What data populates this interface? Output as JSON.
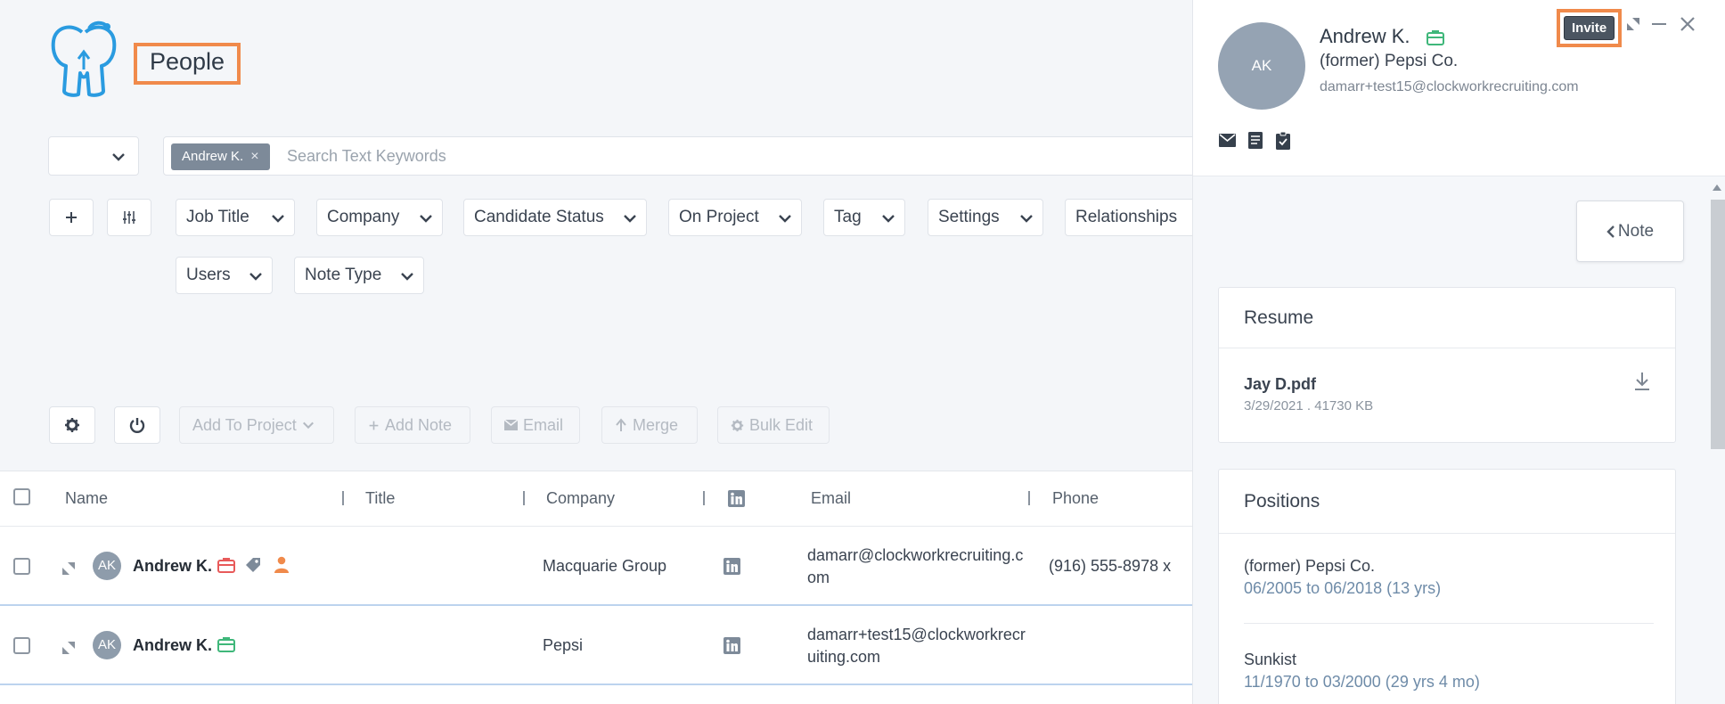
{
  "page": {
    "title": "People"
  },
  "search": {
    "scope_value": "",
    "chip_label": "Andrew K.",
    "chip_remove": "×",
    "placeholder": "Search Text Keywords"
  },
  "filters": {
    "add_icon": "plus-icon",
    "sliders_icon": "sliders-icon",
    "items": [
      {
        "label": "Job Title"
      },
      {
        "label": "Company"
      },
      {
        "label": "Candidate Status"
      },
      {
        "label": "On Project"
      },
      {
        "label": "Tag"
      },
      {
        "label": "Settings"
      },
      {
        "label": "Relationships"
      },
      {
        "label": "Users"
      },
      {
        "label": "Note Type"
      }
    ]
  },
  "actions": {
    "add_to_project": "Add To Project",
    "add_note": "Add Note",
    "email": "Email",
    "merge": "Merge",
    "bulk_edit": "Bulk Edit"
  },
  "table": {
    "columns": {
      "name": "Name",
      "title": "Title",
      "company": "Company",
      "email": "Email",
      "phone": "Phone"
    },
    "rows": [
      {
        "initials": "AK",
        "name": "Andrew K.",
        "title": "",
        "company": "Macquarie Group",
        "email_line1": "damarr@clockworkrecruiting.c",
        "email_line2": "om",
        "phone": "(916) 555-8978 x",
        "icons": [
          "briefcase-icon",
          "tag-icon",
          "person-icon"
        ]
      },
      {
        "initials": "AK",
        "name": "Andrew K.",
        "title": "",
        "company": "Pepsi",
        "email_line1": "damarr+test15@clockworkrecr",
        "email_line2": "uiting.com",
        "phone": "",
        "icons": [
          "briefcase-icon"
        ]
      }
    ]
  },
  "panel": {
    "initials": "AK",
    "name": "Andrew K.",
    "company": "(former) Pepsi Co.",
    "email": "damarr+test15@clockworkrecruiting.com",
    "invite_label": "Invite",
    "note_label": "Note",
    "resume": {
      "title": "Resume",
      "file_name": "Jay D.pdf",
      "meta": "3/29/2021 . 41730 KB"
    },
    "positions": {
      "title": "Positions",
      "items": [
        {
          "company": "(former) Pepsi Co.",
          "dates": "06/2005 to 06/2018 (13 yrs)"
        },
        {
          "company": "Sunkist",
          "dates": "11/1970 to 03/2000 (29 yrs 4 mo)"
        }
      ]
    }
  },
  "colors": {
    "accent_highlight": "#f08a4b",
    "briefcase_green": "#3fb77a",
    "briefcase_red": "#e85a5a",
    "person_orange": "#f08a4b",
    "logo_blue": "#2a9be0"
  }
}
